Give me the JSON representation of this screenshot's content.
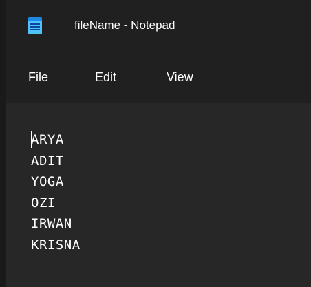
{
  "window": {
    "title": "fileName - Notepad",
    "app_icon": "notepad-icon"
  },
  "menu": {
    "file_label": "File",
    "edit_label": "Edit",
    "view_label": "View"
  },
  "editor": {
    "lines": [
      "ARYA",
      "ADIT",
      "YOGA",
      "OZI",
      "IRWAN",
      "KRISNA"
    ]
  },
  "colors": {
    "background": "#272727",
    "titlebar": "#202020",
    "text": "#ffffff",
    "icon_accent": "#4fc3f7"
  }
}
